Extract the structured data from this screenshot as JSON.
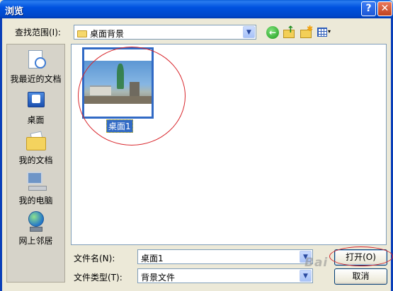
{
  "window": {
    "title": "浏览",
    "help_glyph": "?",
    "close_glyph": "✕"
  },
  "look_in": {
    "label": "查找范围(I):",
    "value": "桌面背景"
  },
  "toolbar": {
    "back_glyph": "←",
    "up_glyph": "↑",
    "new_folder_glyph": "✱",
    "view_caret": "▾",
    "icons": [
      "back-icon",
      "up-folder-icon",
      "new-folder-icon",
      "view-menu-icon"
    ]
  },
  "places": [
    {
      "label": "我最近的文档",
      "icon": "recent-documents-icon"
    },
    {
      "label": "桌面",
      "icon": "desktop-icon"
    },
    {
      "label": "我的文档",
      "icon": "my-documents-icon"
    },
    {
      "label": "我的电脑",
      "icon": "my-computer-icon"
    },
    {
      "label": "网上邻居",
      "icon": "network-places-icon"
    }
  ],
  "files": [
    {
      "name": "桌面1",
      "selected": true,
      "icon": "image-thumbnail"
    }
  ],
  "file_name": {
    "label": "文件名(N):",
    "value": "桌面1"
  },
  "file_type": {
    "label": "文件类型(T):",
    "value": "背景文件"
  },
  "buttons": {
    "open": "打开(O)",
    "cancel": "取消"
  },
  "combo_arrow": "▼",
  "watermark": "Bai",
  "colors": {
    "title_bar": "#0052df",
    "selection": "#316ac5",
    "annotation": "#d8252b",
    "dialog_bg": "#ece9d8"
  }
}
